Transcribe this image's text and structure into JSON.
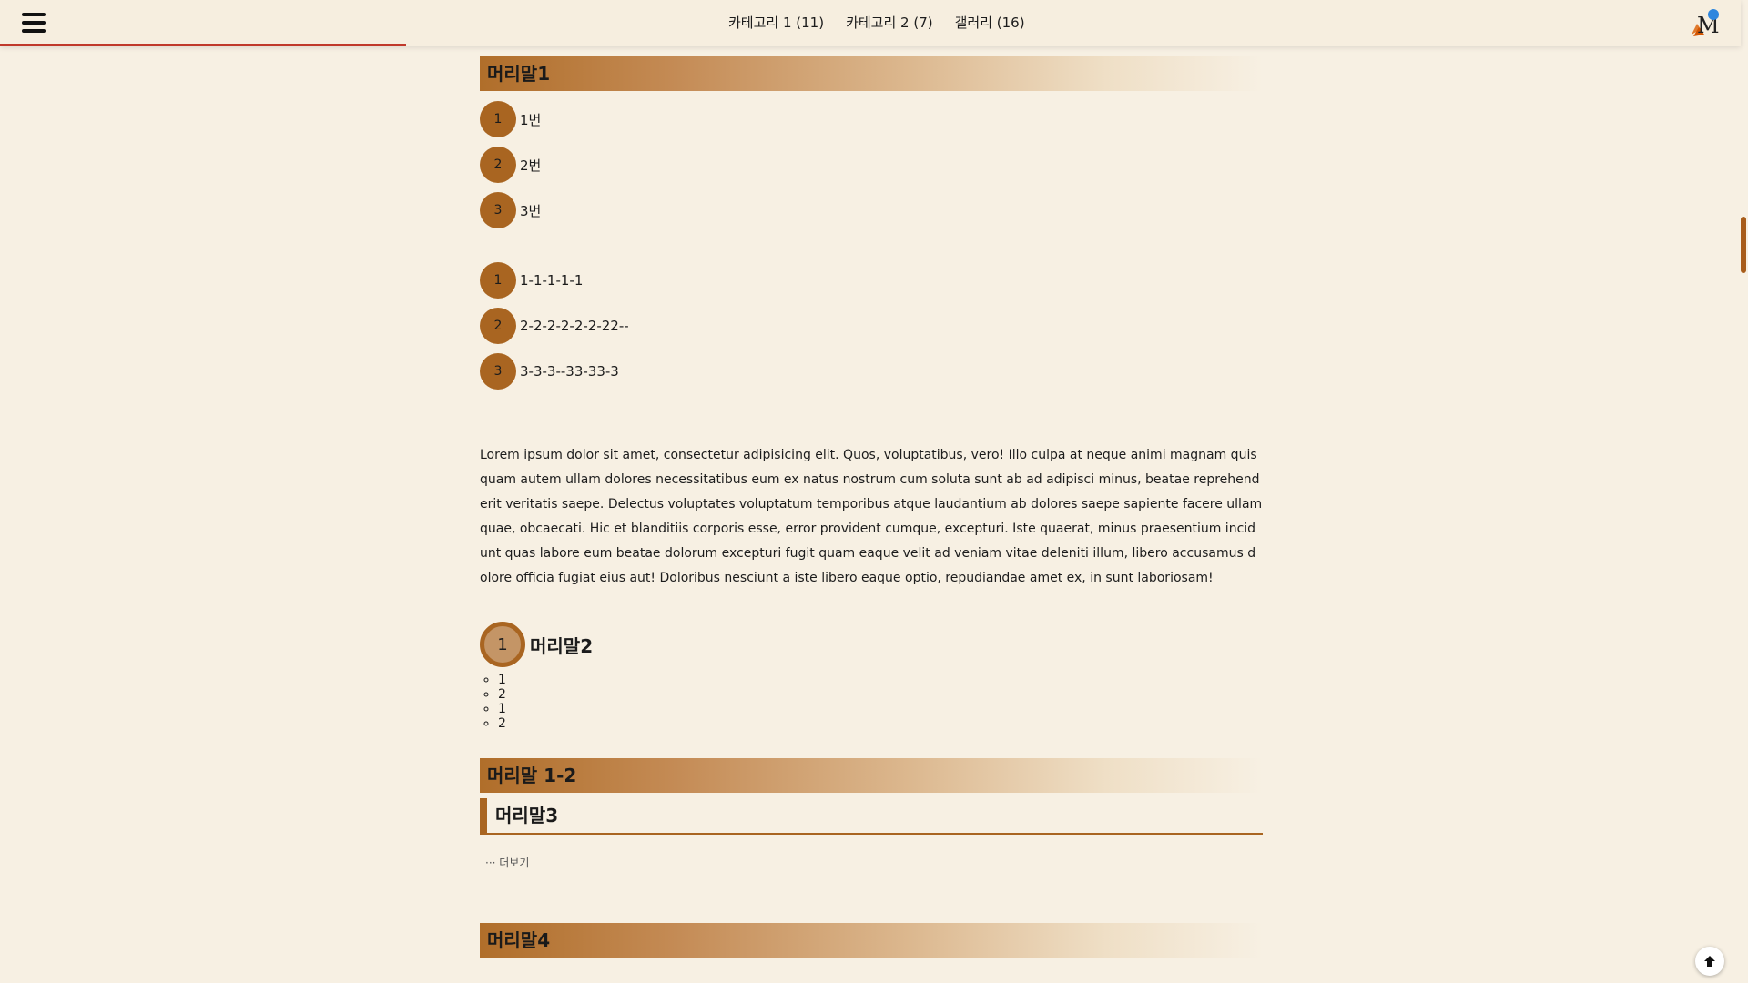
{
  "nav": {
    "links": [
      {
        "label": "카테고리 1 (11)"
      },
      {
        "label": "카테고리 2 (7)"
      },
      {
        "label": "갤러리 (16)"
      }
    ]
  },
  "logo_text": "M",
  "sections": {
    "h1": "머리말1",
    "list1": [
      "1번",
      "2번",
      "3번"
    ],
    "list2": [
      "1-1-1-1-1",
      "2-2-2-2-2-2-22--",
      "3-3-3--33-33-3"
    ],
    "numbers": [
      "1",
      "2",
      "3"
    ],
    "paragraph": "Lorem ipsum dolor sit amet, consectetur adipisicing elit. Quos, voluptatibus, vero! Illo culpa at neque animi magnam quisquam autem ullam dolores necessitatibus eum ex natus nostrum cum soluta sunt ab ad adipisci minus, beatae reprehenderit veritatis saepe. Delectus voluptates voluptatum temporibus atque laudantium ab dolores saepe sapiente facere ullam quae, obcaecati. Hic et blanditiis corporis esse, error provident cumque, excepturi. Iste quaerat, minus praesentium incidunt quas labore eum beatae dolorum excepturi fugit quam eaque velit ad veniam vitae deleniti illum, libero accusamus dolore officia fugiat eius aut! Doloribus nesciunt a iste libero eaque optio, repudiandae amet ex, in sunt laboriosam!",
    "h2_number": "1",
    "h2": "머리말2",
    "bullets": [
      "1",
      "2",
      "1",
      "2"
    ],
    "h1_2": "머리말 1-2",
    "h3": "머리말3",
    "more": "··· 더보기",
    "h4": "머리말4"
  },
  "colors": {
    "accent": "#a96521",
    "background": "#f7f0e3",
    "progress": "#c0392b"
  },
  "icons": [
    "hamburger-menu-icon",
    "blog-logo-icon",
    "arrow-up-icon"
  ]
}
